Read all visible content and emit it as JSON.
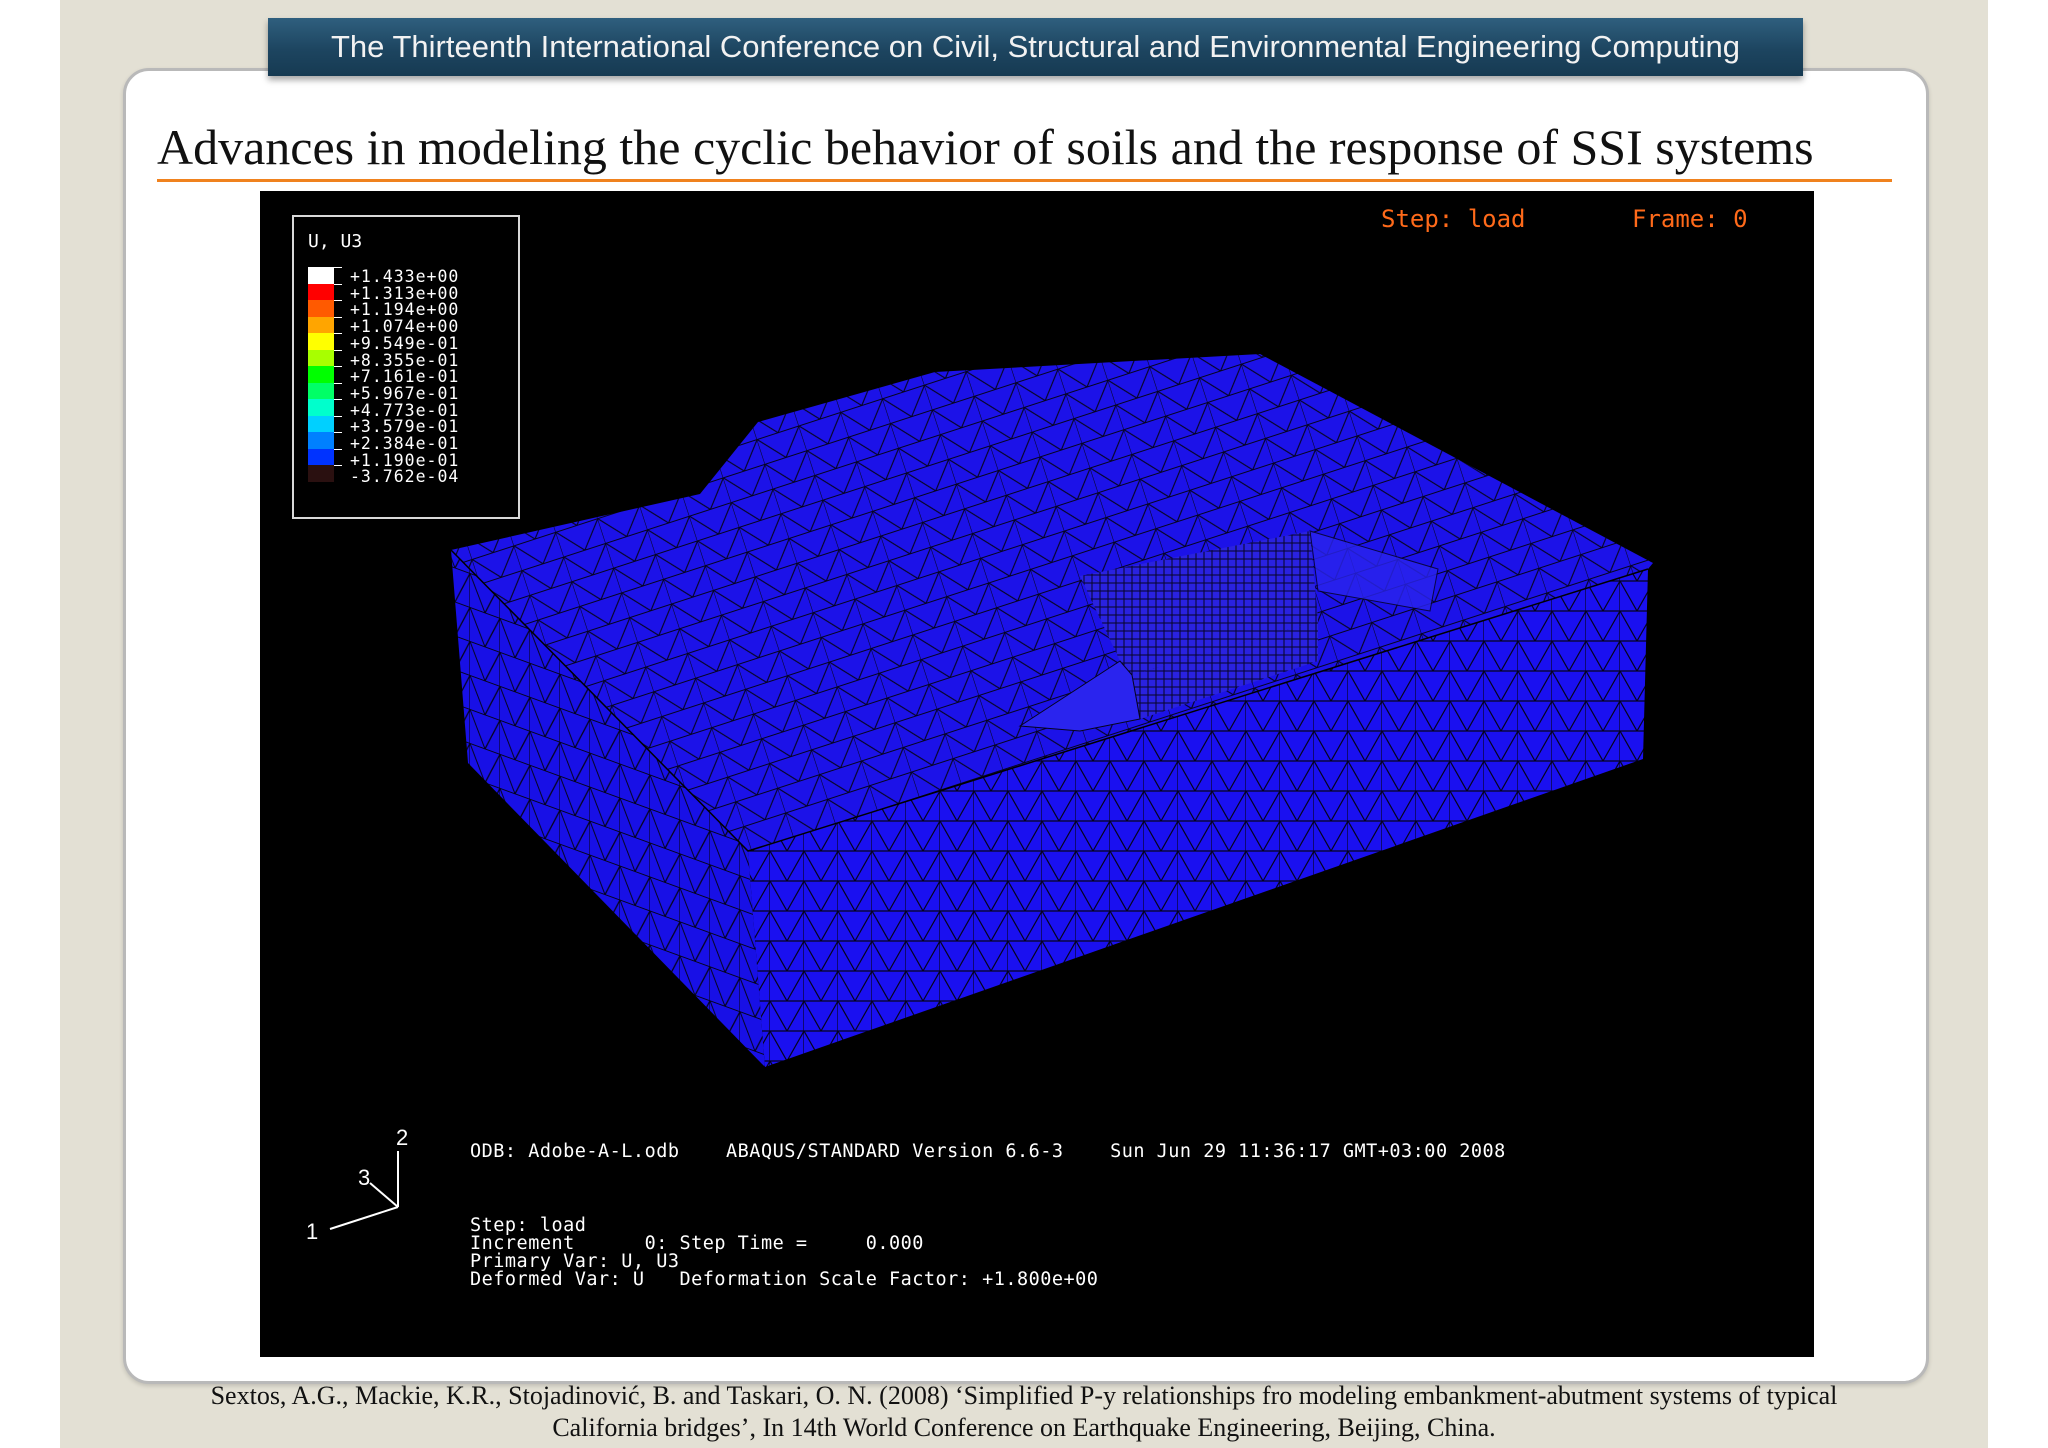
{
  "header": {
    "conference": "The Thirteenth International Conference on Civil, Structural and Environmental Engineering Computing"
  },
  "slide": {
    "title": "Advances in modeling the cyclic behavior of soils and the response of SSI systems"
  },
  "viewport": {
    "legend": {
      "title": "U, U3",
      "values": [
        "+1.433e+00",
        "+1.313e+00",
        "+1.194e+00",
        "+1.074e+00",
        "+9.549e-01",
        "+8.355e-01",
        "+7.161e-01",
        "+5.967e-01",
        "+4.773e-01",
        "+3.579e-01",
        "+2.384e-01",
        "+1.190e-01",
        "-3.762e-04"
      ],
      "colors": [
        "#ffffff",
        "#ff0000",
        "#ff5a00",
        "#ffa500",
        "#ffff00",
        "#a8ff00",
        "#00ff00",
        "#00ff66",
        "#00ffcc",
        "#00d0ff",
        "#0080ff",
        "#0033ff",
        "#2a1010"
      ]
    },
    "step_label": "Step: load",
    "frame_label": "Frame: 0",
    "axes": {
      "x": "1",
      "y": "2",
      "z": "3"
    },
    "odb_line": "ODB: Adobe-A-L.odb    ABAQUS/STANDARD Version 6.6-3    Sun Jun 29 11:36:17 GMT+03:00 2008",
    "step_line": "Step: load",
    "increment_line": "Increment      0: Step Time =     0.000",
    "primary_var_line": "Primary Var: U, U3",
    "deformed_var_line": "Deformed Var: U   Deformation Scale Factor: +1.800e+00",
    "mesh_color": "#1a10f0"
  },
  "citation": {
    "line1": "Sextos, A.G., Mackie, K.R., Stojadinović, B. and Taskari, O. N. (2008) ‘Simplified P-y relationships fro modeling embankment-abutment systems of typical",
    "line2": "California bridges’, In 14th World Conference on Earthquake Engineering, Beijing, China."
  }
}
